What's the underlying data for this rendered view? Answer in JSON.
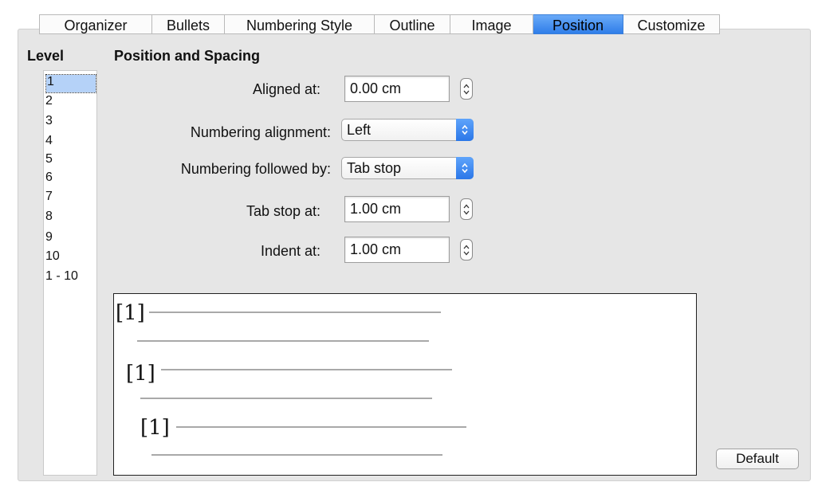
{
  "tabs": [
    {
      "label": "Organizer",
      "active": false
    },
    {
      "label": "Bullets",
      "active": false
    },
    {
      "label": "Numbering Style",
      "active": false
    },
    {
      "label": "Outline",
      "active": false
    },
    {
      "label": "Image",
      "active": false
    },
    {
      "label": "Position",
      "active": true
    },
    {
      "label": "Customize",
      "active": false
    }
  ],
  "level": {
    "title": "Level",
    "items": [
      "1",
      "2",
      "3",
      "4",
      "5",
      "6",
      "7",
      "8",
      "9",
      "10",
      "1 - 10"
    ],
    "selected": "1"
  },
  "position": {
    "title": "Position and Spacing",
    "aligned_at": {
      "label": "Aligned at:",
      "value": "0.00 cm"
    },
    "numbering_alignment": {
      "label": "Numbering alignment:",
      "value": "Left"
    },
    "numbering_followed_by": {
      "label": "Numbering followed by:",
      "value": "Tab stop"
    },
    "tab_stop_at": {
      "label": "Tab stop at:",
      "value": "1.00 cm"
    },
    "indent_at": {
      "label": "Indent at:",
      "value": "1.00 cm"
    }
  },
  "preview": {
    "numbers": [
      "[1]",
      "[1]",
      "[1]"
    ]
  },
  "buttons": {
    "default_label": "Default"
  },
  "colors": {
    "active_tab": "#2f7ee9",
    "dialog_background": "#e6e6e6",
    "selection": "#b5d2f8"
  }
}
